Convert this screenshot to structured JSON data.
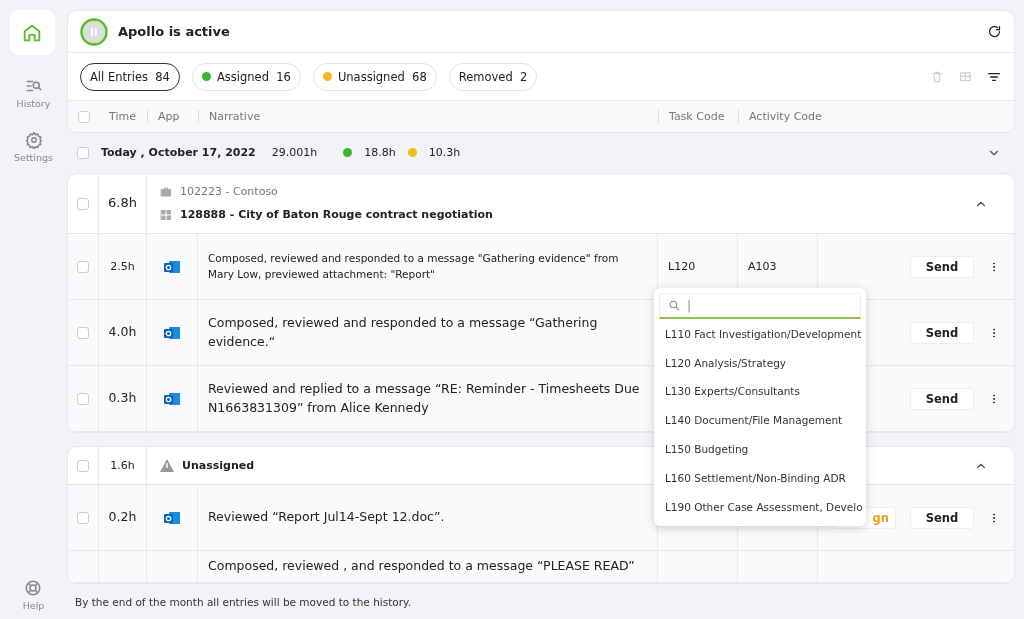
{
  "sidebar": {
    "items": [
      {
        "kind": "home",
        "selected": true
      },
      {
        "kind": "history",
        "label": "History",
        "selected": false
      },
      {
        "kind": "settings",
        "label": "Settings",
        "selected": false
      }
    ],
    "help": "Help"
  },
  "header": {
    "title": "Apollo is active",
    "active": true
  },
  "filters": [
    {
      "label": "All Entries",
      "count": "84",
      "selected": true
    },
    {
      "label": "Assigned",
      "count": "16",
      "color": "#3cb531",
      "selected": false
    },
    {
      "label": "Unassigned",
      "count": "68",
      "color": "#f5b91e",
      "selected": false
    },
    {
      "label": "Removed",
      "count": "2",
      "selected": false
    }
  ],
  "select_all": {
    "checked": false
  },
  "columns": [
    "Time",
    "App",
    "Narrative",
    "Task Code",
    "Activity Code"
  ],
  "day": {
    "label": "Today , October 17, 2022",
    "total": "29.001h",
    "assigned": "18.8h",
    "unassigned": "10.3h",
    "expanded": false,
    "checked": false
  },
  "groups": [
    {
      "kind": "matter",
      "time": "6.8h",
      "client": "102223 - Contoso",
      "matter": "128888 - City of Baton Rouge contract negotiation",
      "expanded": true,
      "checked": false,
      "rows": [
        {
          "time": "2.5h",
          "narrative": "Composed, reviewed and responded to a message \"Gathering evidence\" from Mary Low, previewed attachment: \"Report\"",
          "small": true,
          "checked": false,
          "task": "L120",
          "activity": "A103",
          "send": "Send"
        },
        {
          "time": "4.0h",
          "narrative": "Composed, reviewed and responded to a message “Gathering evidence.“",
          "small": false,
          "checked": false,
          "send": "Send"
        },
        {
          "time": "0.3h",
          "narrative": "Reviewed and replied to a message “RE: Reminder - Timesheets Due N1663831309” from Alice Kennedy",
          "small": false,
          "checked": false,
          "send": "Send"
        }
      ]
    },
    {
      "kind": "unassigned",
      "time": "1.6h",
      "matter": "Unassigned",
      "expanded": true,
      "checked": false,
      "rows": [
        {
          "time": "0.2h",
          "narrative": "Reviewed “Report Jul14-Sept 12.doc”.",
          "small": false,
          "checked": false,
          "assign": "gn",
          "send": "Send"
        },
        {
          "narrative": "Composed, reviewed , and responded to a message “PLEASE READ”",
          "partial": true
        }
      ]
    }
  ],
  "dropdown": {
    "value": "|",
    "items": [
      "L110 Fact Investigation/Development",
      "L120 Analysis/Strategy",
      "L130 Experts/Consultants",
      "L140 Document/File Management",
      "L150 Budgeting",
      "L160 Settlement/Non-Binding ADR",
      "L190 Other Case Assessment, Develo"
    ]
  },
  "footer": "By the end of the month all entries will be moved to the history."
}
